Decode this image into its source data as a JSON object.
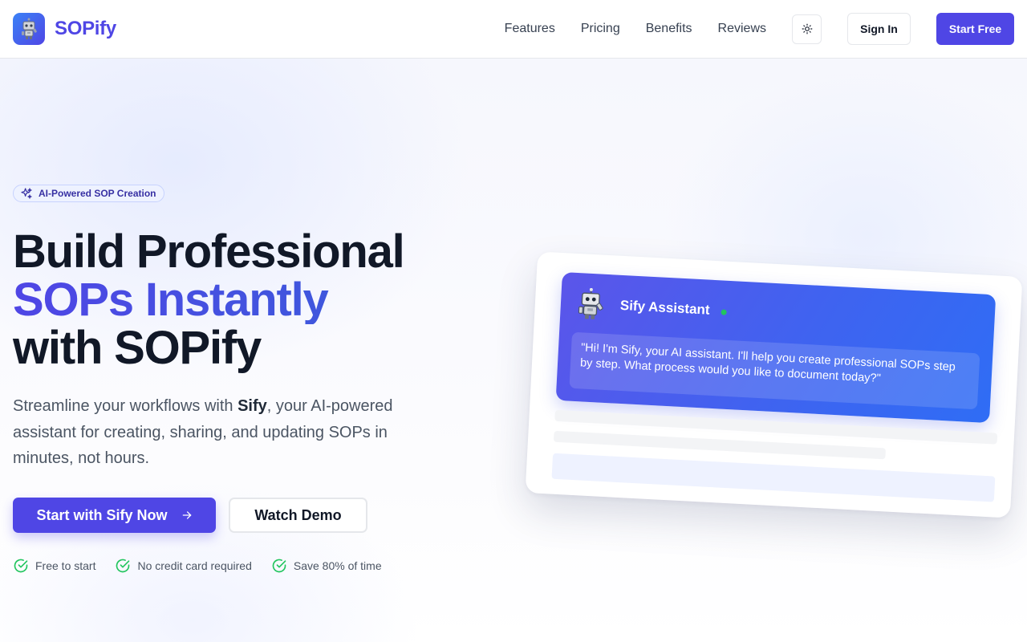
{
  "header": {
    "brand": "SOPify",
    "nav": [
      "Features",
      "Pricing",
      "Benefits",
      "Reviews"
    ],
    "sign_in": "Sign In",
    "start_free": "Start Free"
  },
  "hero": {
    "badge": "AI-Powered SOP Creation",
    "headline_line1": "Build Professional",
    "headline_line2": "SOPs Instantly",
    "headline_line3": "with SOPify",
    "subtext_before": "Streamline your workflows with ",
    "subtext_bold": "Sify",
    "subtext_after": ", your AI-powered assistant for creating, sharing, and updating SOPs in minutes, not hours.",
    "cta_primary": "Start with Sify Now",
    "cta_secondary": "Watch Demo",
    "perks": [
      "Free to start",
      "No credit card required",
      "Save 80% of time"
    ]
  },
  "preview": {
    "assistant_name": "Sify Assistant",
    "message": "\"Hi! I'm Sify, your AI assistant. I'll help you create professional SOPs step by step. What process would you like to document today?\""
  },
  "colors": {
    "brand": "#4f46e5",
    "success": "#22c55e"
  },
  "icons": {
    "logo": "robot-icon",
    "theme_toggle": "sun-icon",
    "badge": "sparkles-icon",
    "cta_arrow": "arrow-right-icon",
    "perk": "check-circle-icon"
  }
}
